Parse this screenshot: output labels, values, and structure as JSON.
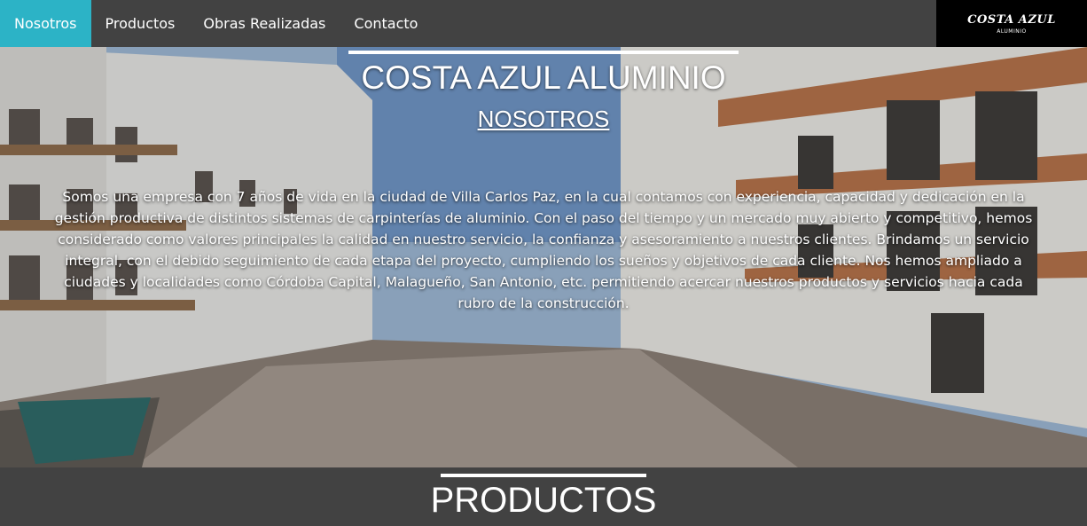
{
  "nav": {
    "items": [
      {
        "label": "Nosotros",
        "active": true
      },
      {
        "label": "Productos",
        "active": false
      },
      {
        "label": "Obras Realizadas",
        "active": false
      },
      {
        "label": "Contacto",
        "active": false
      }
    ],
    "logo": {
      "main": "COSTA AZUL",
      "sub": "ALUMINIO"
    }
  },
  "hero": {
    "title": "COSTA AZUL ALUMINIO",
    "subtitle": "NOSOTROS",
    "text": "Somos una empresa con 7 años de vida en la ciudad de Villa Carlos Paz, en la cual contamos con experiencia, capacidad y dedicación en la gestión productiva de distintos sistemas de carpinterías de aluminio. Con el paso del tiempo y un mercado muy abierto y competitivo, hemos considerado como valores principales la calidad en nuestro servicio, la confianza y asesoramiento a nuestros clientes. Brindamos un servicio integral, con el debido seguimiento de cada etapa del proyecto, cumpliendo los sueños y objetivos de cada cliente. Nos hemos ampliado a ciudades y localidades como Córdoba Capital, Malagueño, San Antonio, etc. permitiendo acercar nuestros productos y servicios hacia cada rubro de la construcción."
  },
  "products": {
    "title": "PRODUCTOS"
  },
  "colors": {
    "nav_bg": "#424242",
    "nav_active": "#2cb3c6",
    "logo_bg": "#000000"
  }
}
